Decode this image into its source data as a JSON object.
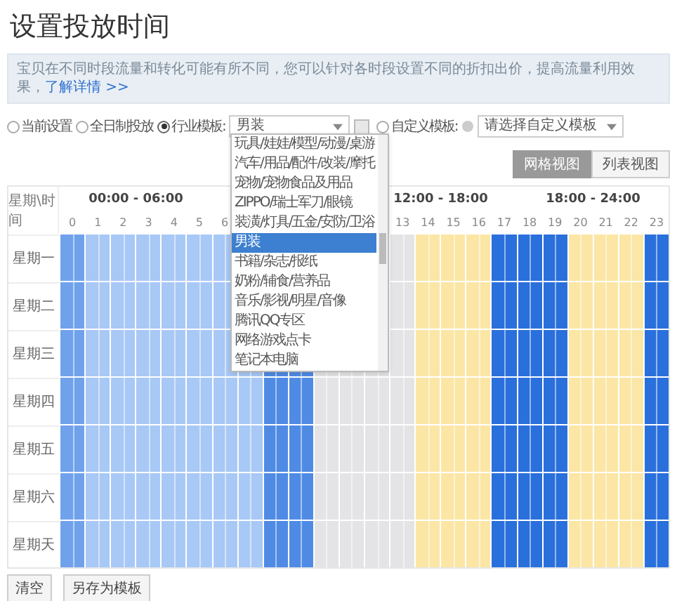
{
  "title": "设置投放时间",
  "notice": {
    "text": "宝贝在不同时段流量和转化可能有所不同，您可以针对各时段设置不同的折扣出价，提高流量利用效果，",
    "link": "了解详情 >>"
  },
  "modes": [
    {
      "label": "当前设置",
      "selected": false
    },
    {
      "label": "全日制投放",
      "selected": false
    },
    {
      "label": "行业模板:",
      "selected": true
    },
    {
      "label": "自定义模板:",
      "selected": false
    }
  ],
  "industry_select": {
    "value": "男装",
    "options": [
      {
        "label": "玩具/娃娃/模型/动漫/桌游",
        "selected": false
      },
      {
        "label": "汽车/用品/配件/改装/摩托",
        "selected": false
      },
      {
        "label": "宠物/宠物食品及用品",
        "selected": false
      },
      {
        "label": "ZIPPO/瑞士军刀/眼镜",
        "selected": false
      },
      {
        "label": "装潢/灯具/五金/安防/卫浴",
        "selected": false
      },
      {
        "label": "男装",
        "selected": true
      },
      {
        "label": "书籍/杂志/报纸",
        "selected": false
      },
      {
        "label": "奶粉/辅食/营养品",
        "selected": false
      },
      {
        "label": "音乐/影视/明星/音像",
        "selected": false
      },
      {
        "label": "腾讯QQ专区",
        "selected": false
      },
      {
        "label": "网络游戏点卡",
        "selected": false
      },
      {
        "label": "笔记本电脑",
        "selected": false
      }
    ]
  },
  "custom_select": {
    "placeholder": "请选择自定义模板"
  },
  "views": [
    {
      "label": "网格视图",
      "selected": true
    },
    {
      "label": "列表视图",
      "selected": false
    }
  ],
  "grid": {
    "corner": "星期\\时间",
    "periods": [
      {
        "label": "00:00 - 06:00"
      },
      {
        "label": "12:00 - 18:00"
      },
      {
        "label": "18:00 - 24:00"
      }
    ],
    "hours": [
      {
        "label": "0",
        "color": "#70a2ec"
      },
      {
        "label": "1",
        "color": "#a8c8f6"
      },
      {
        "label": "2",
        "color": "#a8c8f6"
      },
      {
        "label": "3",
        "color": "#a8c8f6"
      },
      {
        "label": "4",
        "color": "#a8c8f6"
      },
      {
        "label": "5",
        "color": "#a8c8f6"
      },
      {
        "label": "6",
        "color": "#a8c8f6"
      },
      {
        "color": "#a8c8f6"
      },
      {
        "color": "#4f8be4"
      },
      {
        "color": "#4f8be4"
      },
      {
        "color": "#e4e4e6"
      },
      {
        "color": "#e4e4e6"
      },
      {
        "color": "#e4e4e6"
      },
      {
        "label": "13",
        "color": "#e4e4e6"
      },
      {
        "label": "14",
        "color": "#fbe6a6"
      },
      {
        "label": "15",
        "color": "#fbe6a6"
      },
      {
        "label": "16",
        "color": "#fbe6a6"
      },
      {
        "label": "17",
        "color": "#2a70dc"
      },
      {
        "label": "18",
        "color": "#2a70dc"
      },
      {
        "label": "19",
        "color": "#2a70dc"
      },
      {
        "label": "20",
        "color": "#fbe6a6"
      },
      {
        "label": "21",
        "color": "#fbe6a6"
      },
      {
        "label": "22",
        "color": "#fbe6a6"
      },
      {
        "label": "23",
        "color": "#2a70dc"
      }
    ],
    "days": [
      "星期一",
      "星期二",
      "星期三",
      "星期四",
      "星期五",
      "星期六",
      "星期天"
    ]
  },
  "buttons": [
    "清空",
    "另存为模板"
  ]
}
